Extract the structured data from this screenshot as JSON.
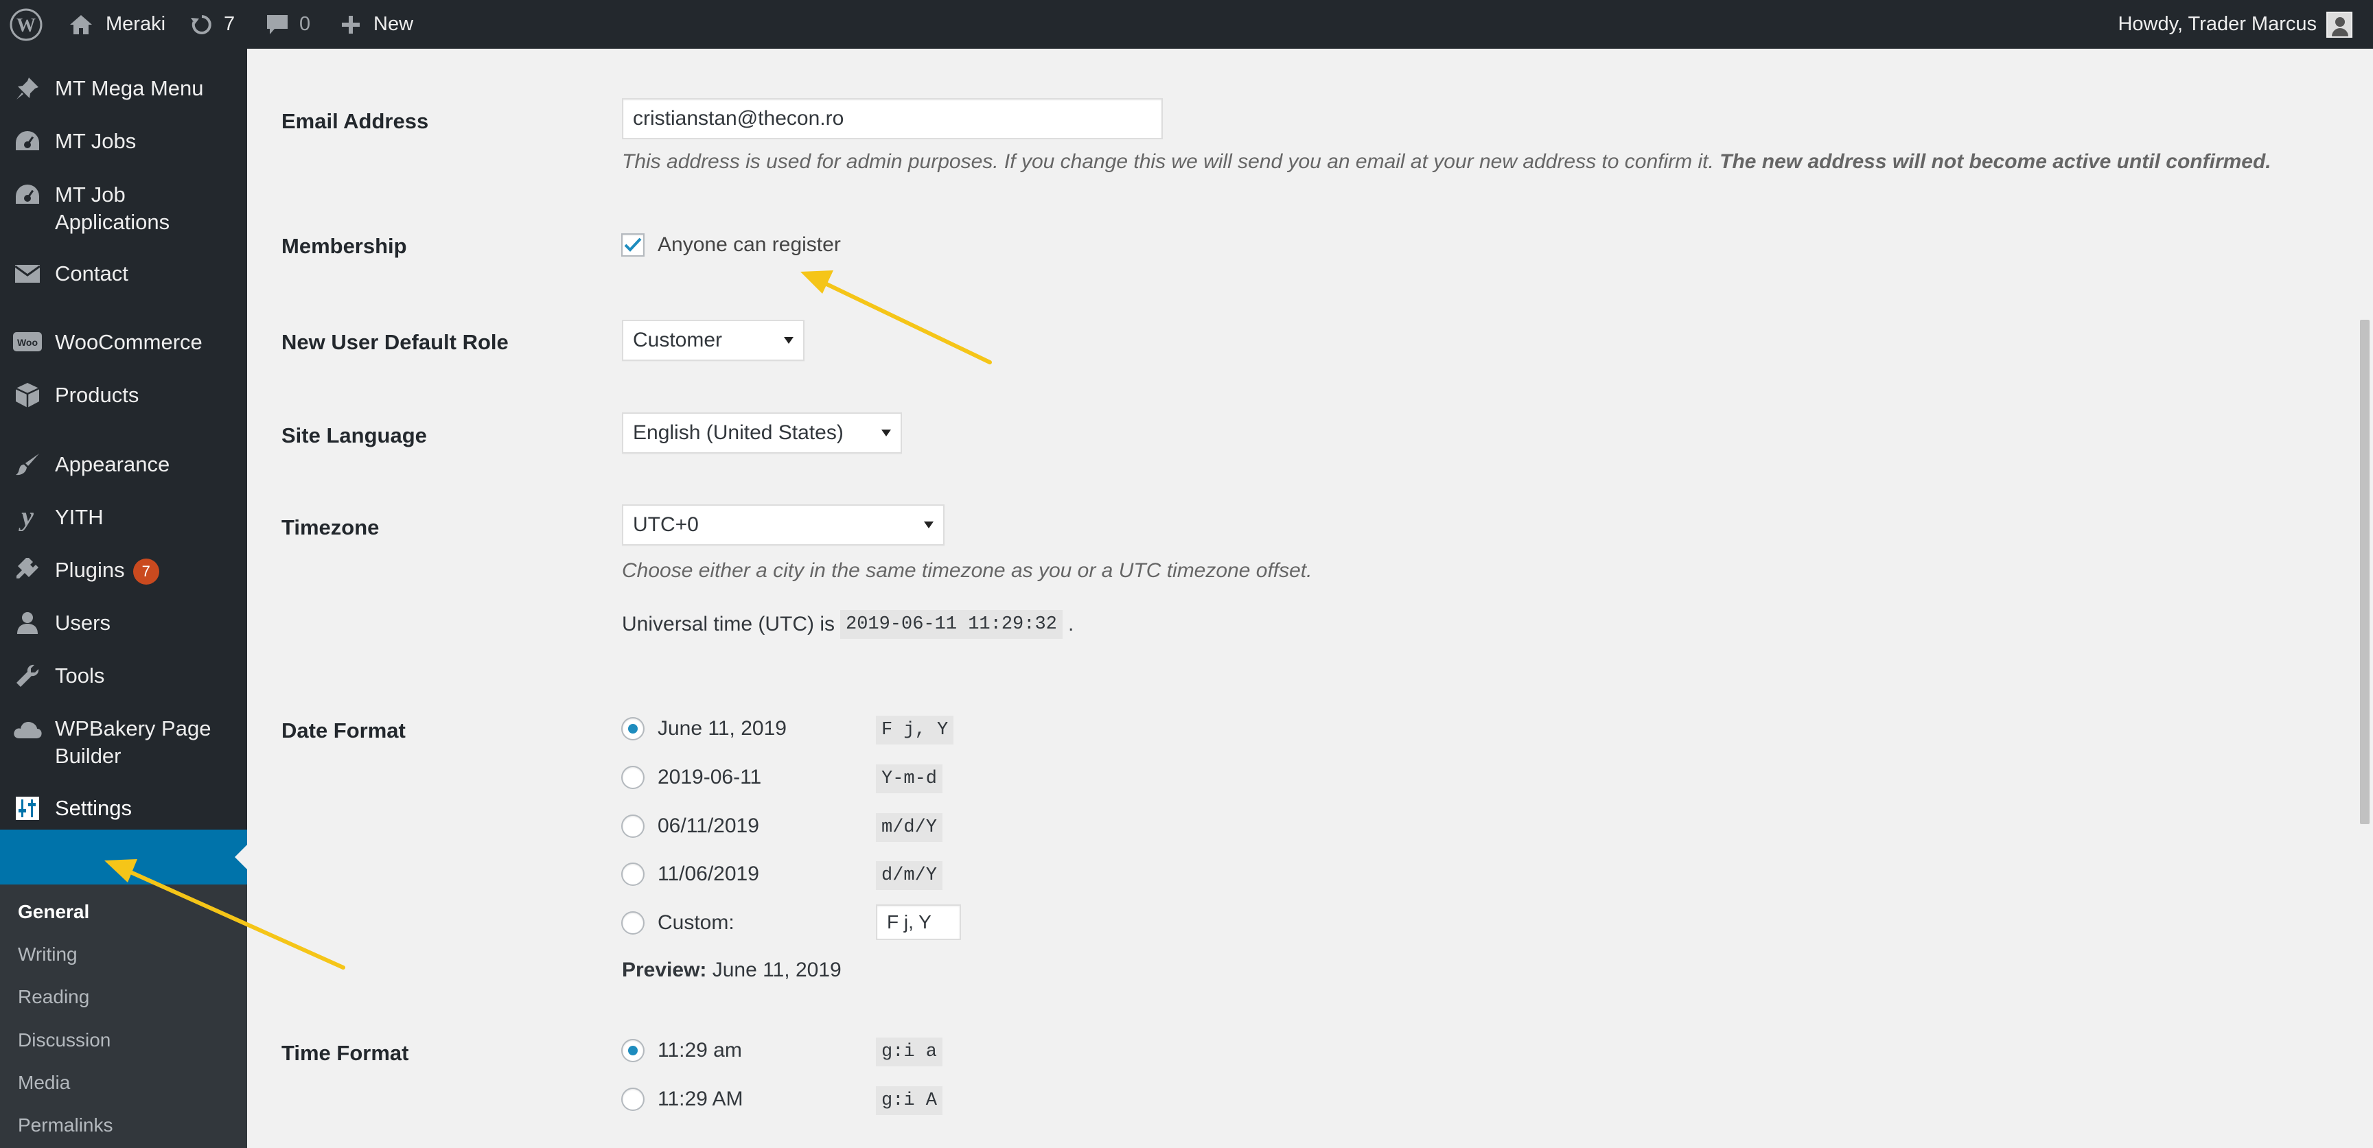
{
  "adminbar": {
    "site_name": "Meraki",
    "updates_count": "7",
    "comments_count": "0",
    "new_label": "New",
    "howdy": "Howdy, Trader Marcus"
  },
  "sidebar": {
    "items": [
      {
        "label": "MT Mega Menu",
        "icon": "pin-icon"
      },
      {
        "label": "MT Jobs",
        "icon": "dashboard-gauge-icon"
      },
      {
        "label": "MT Job Applications",
        "icon": "dashboard-gauge-icon"
      },
      {
        "label": "Contact",
        "icon": "envelope-icon"
      },
      {
        "label": "WooCommerce",
        "icon": "woocommerce-icon"
      },
      {
        "label": "Products",
        "icon": "box-icon"
      },
      {
        "label": "Appearance",
        "icon": "paintbrush-icon"
      },
      {
        "label": "YITH",
        "icon": "yith-icon"
      },
      {
        "label": "Plugins",
        "icon": "plugin-icon",
        "badge": "7"
      },
      {
        "label": "Users",
        "icon": "user-icon"
      },
      {
        "label": "Tools",
        "icon": "wrench-icon"
      },
      {
        "label": "WPBakery Page Builder",
        "icon": "cloud-icon"
      },
      {
        "label": "Settings",
        "icon": "settings-sliders-icon"
      }
    ],
    "submenu": [
      "General",
      "Writing",
      "Reading",
      "Discussion",
      "Media",
      "Permalinks"
    ]
  },
  "settings": {
    "email": {
      "label": "Email Address",
      "value": "cristianstan@thecon.ro",
      "desc": "This address is used for admin purposes. If you change this we will send you an email at your new address to confirm it.",
      "desc_strong": "The new address will not become active until confirmed."
    },
    "membership": {
      "label": "Membership",
      "checkbox_label": "Anyone can register",
      "checked": true
    },
    "default_role": {
      "label": "New User Default Role",
      "value": "Customer"
    },
    "site_language": {
      "label": "Site Language",
      "value": "English (United States)"
    },
    "timezone": {
      "label": "Timezone",
      "value": "UTC+0",
      "desc": "Choose either a city in the same timezone as you or a UTC timezone offset.",
      "utc_prefix": "Universal time (UTC) is",
      "utc_time": "2019-06-11 11:29:32",
      "utc_suffix": "."
    },
    "date_format": {
      "label": "Date Format",
      "options": [
        {
          "label": "June 11, 2019",
          "code": "F j, Y",
          "selected": true
        },
        {
          "label": "2019-06-11",
          "code": "Y-m-d"
        },
        {
          "label": "06/11/2019",
          "code": "m/d/Y"
        },
        {
          "label": "11/06/2019",
          "code": "d/m/Y"
        }
      ],
      "custom_label": "Custom:",
      "custom_value": "F j, Y",
      "preview_label": "Preview:",
      "preview_value": "June 11, 2019"
    },
    "time_format": {
      "label": "Time Format",
      "options": [
        {
          "label": "11:29 am",
          "code": "g:i a",
          "selected": true
        },
        {
          "label": "11:29 AM",
          "code": "g:i A"
        }
      ]
    }
  },
  "colors": {
    "admin_dark": "#23282d",
    "accent_blue": "#0073aa",
    "badge_orange": "#ca4a1f",
    "annotation_yellow": "#f5c518"
  }
}
